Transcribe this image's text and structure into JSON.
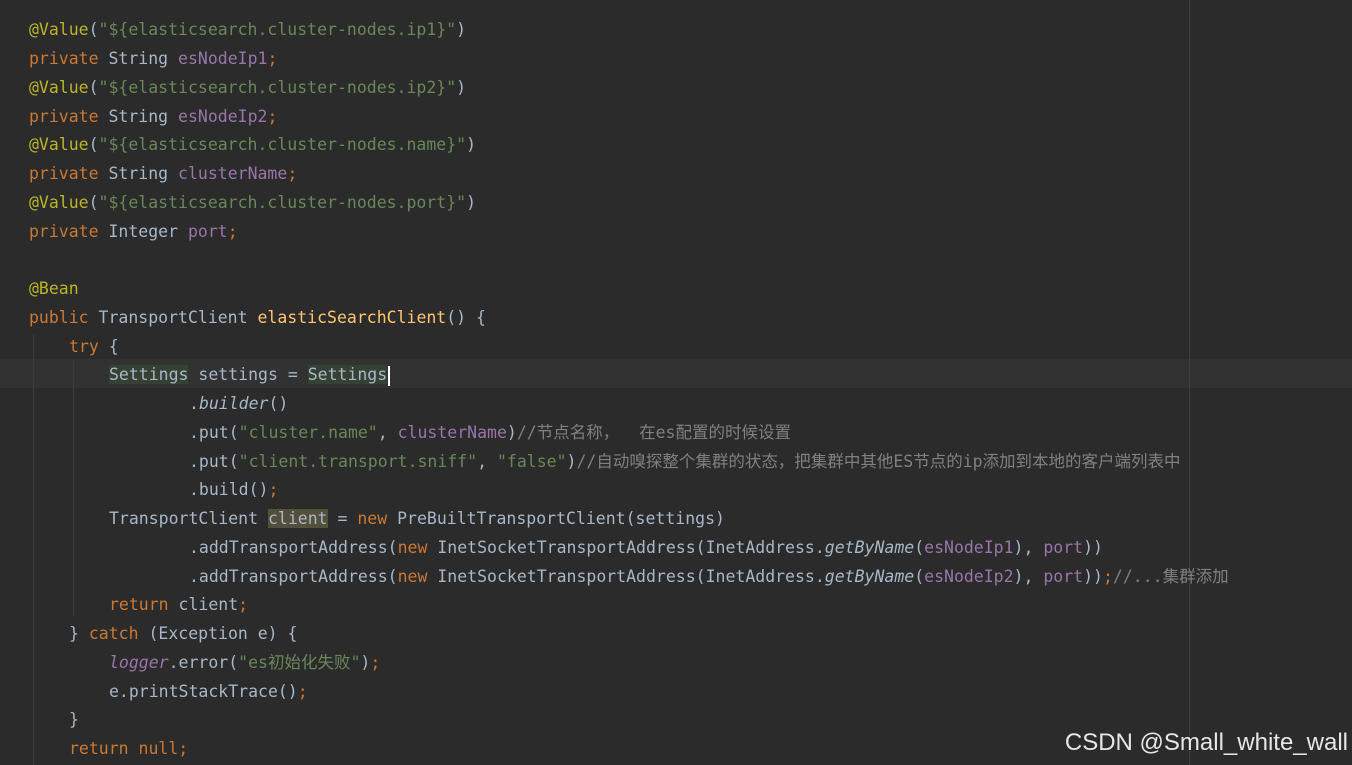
{
  "code": {
    "l1": {
      "ann": "@Value",
      "p": "(",
      "s": "\"${elasticsearch.cluster-nodes.ip1}\"",
      "e": ")"
    },
    "l2": {
      "kw": "private",
      "t": " String ",
      "f": "esNodeIp1",
      "e": ";"
    },
    "l3": {
      "ann": "@Value",
      "p": "(",
      "s": "\"${elasticsearch.cluster-nodes.ip2}\"",
      "e": ")"
    },
    "l4": {
      "kw": "private",
      "t": " String ",
      "f": "esNodeIp2",
      "e": ";"
    },
    "l5": {
      "ann": "@Value",
      "p": "(",
      "s": "\"${elasticsearch.cluster-nodes.name}\"",
      "e": ")"
    },
    "l6": {
      "kw": "private",
      "t": " String ",
      "f": "clusterName",
      "e": ";"
    },
    "l7": {
      "ann": "@Value",
      "p": "(",
      "s": "\"${elasticsearch.cluster-nodes.port}\"",
      "e": ")"
    },
    "l8": {
      "kw": "private",
      "t": " Integer ",
      "f": "port",
      "e": ";"
    },
    "l9": {
      "ann": "@Bean"
    },
    "l10": {
      "kw": "public",
      "t": " TransportClient ",
      "fn": "elasticSearchClient",
      "e": "() {"
    },
    "l11": {
      "kw": "try",
      "e": " {"
    },
    "l12": {
      "a": "Settings",
      "b": " settings = ",
      "c": "Settings"
    },
    "l13": {
      "a": ".",
      "b": "builder",
      "c": "()"
    },
    "l14": {
      "a": ".put(",
      "s": "\"cluster.name\"",
      "b": ", ",
      "f": "clusterName",
      "c": ")",
      "cm": "//节点名称，  在es配置的时候设置"
    },
    "l15": {
      "a": ".put(",
      "s1": "\"client.transport.sniff\"",
      "b": ", ",
      "s2": "\"false\"",
      "c": ")",
      "cm": "//自动嗅探整个集群的状态，把集群中其他ES节点的ip添加到本地的客户端列表中"
    },
    "l16": {
      "a": ".build()",
      "e": ";"
    },
    "l17": {
      "a": "TransportClient ",
      "v": "client",
      "b": " = ",
      "kw": "new",
      "c": " PreBuiltTransportClient(settings)"
    },
    "l18": {
      "a": ".addTransportAddress(",
      "kw": "new",
      "b": " InetSocketTransportAddress(InetAddress.",
      "m": "getByName",
      "c": "(",
      "f1": "esNodeIp1",
      "d": "), ",
      "f2": "port",
      "e": "))"
    },
    "l19": {
      "a": ".addTransportAddress(",
      "kw": "new",
      "b": " InetSocketTransportAddress(InetAddress.",
      "m": "getByName",
      "c": "(",
      "f1": "esNodeIp2",
      "d": "), ",
      "f2": "port",
      "e": "))",
      "semi": ";",
      "cm": "//...集群添加"
    },
    "l20": {
      "kw": "return",
      "t": " client",
      "e": ";"
    },
    "l21": {
      "a": "} ",
      "kw": "catch",
      "b": " (Exception e) {"
    },
    "l22": {
      "lg": "logger",
      "a": ".error(",
      "s": "\"es初始化失败\"",
      "b": ")",
      "e": ";"
    },
    "l23": {
      "a": "e.printStackTrace()",
      "e": ";"
    },
    "l24": {
      "a": "}"
    },
    "l25": {
      "kw": "return",
      "b": " null",
      "e": ";"
    }
  },
  "watermark": "CSDN @Small_white_wall"
}
